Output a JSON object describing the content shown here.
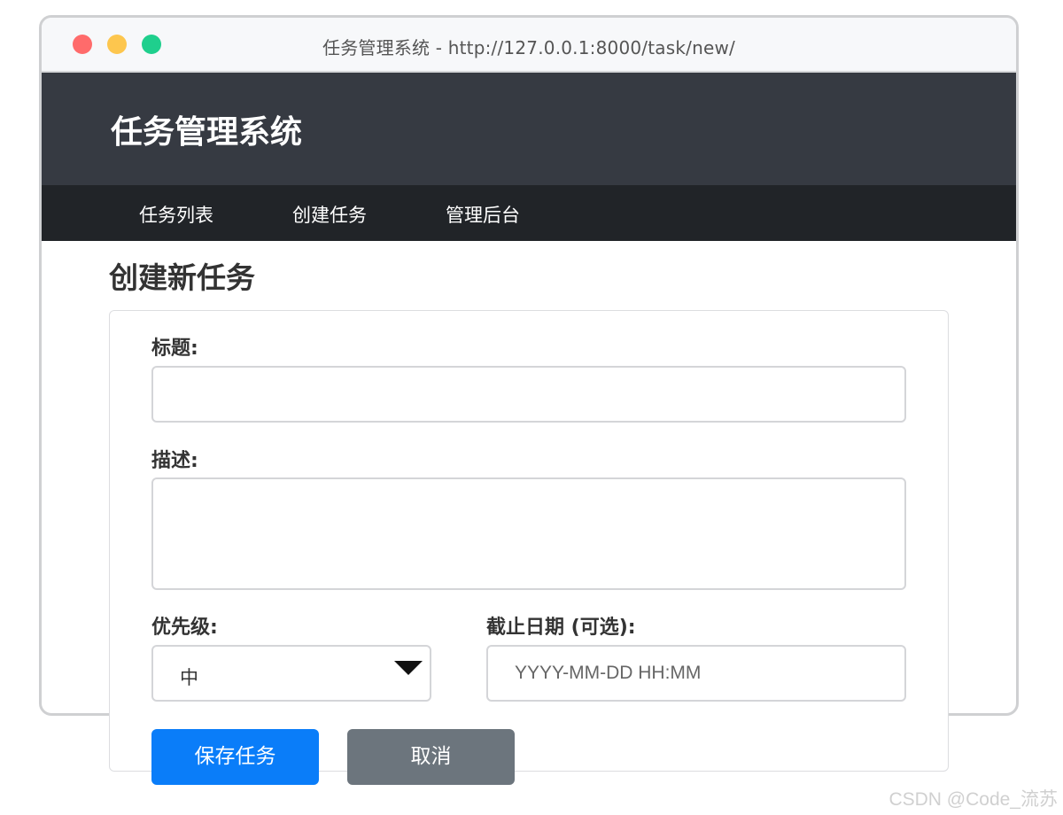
{
  "window": {
    "title": "任务管理系统 - http://127.0.0.1:8000/task/new/"
  },
  "header": {
    "site_title": "任务管理系统"
  },
  "nav": {
    "items": [
      {
        "label": "任务列表"
      },
      {
        "label": "创建任务"
      },
      {
        "label": "管理后台"
      }
    ]
  },
  "page": {
    "heading": "创建新任务"
  },
  "form": {
    "title_label": "标题:",
    "title_value": "",
    "description_label": "描述:",
    "description_value": "",
    "priority_label": "优先级:",
    "priority_value": "中",
    "deadline_label": "截止日期 (可选):",
    "deadline_placeholder": "YYYY-MM-DD HH:MM",
    "save_label": "保存任务",
    "cancel_label": "取消"
  },
  "watermark": {
    "text": "CSDN @Code_流苏"
  },
  "colors": {
    "header_bg": "#363a42",
    "nav_bg": "#212428",
    "primary_button": "#0a7df9",
    "secondary_button": "#6c757d",
    "traffic_close": "#ff6b6b",
    "traffic_minimize": "#fdc64e",
    "traffic_maximize": "#1fcf8d"
  }
}
